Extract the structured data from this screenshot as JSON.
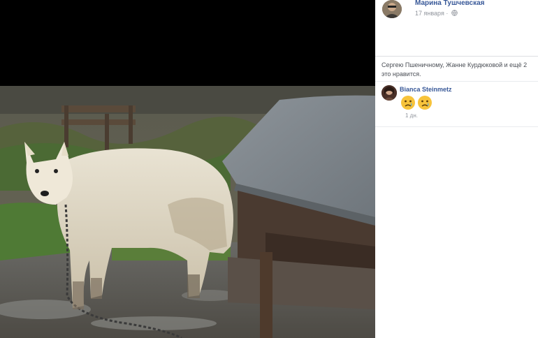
{
  "post": {
    "author": "Марина Тушчевская",
    "date": "17 января",
    "date_separator": "·",
    "privacy_icon": "globe-icon"
  },
  "reactions": {
    "likes_text": "Сергею Пшеничному, Жанне Курдюковой и ещё 2 это нравится."
  },
  "comments": [
    {
      "author": "Bianca Steinmetz",
      "content_icons": [
        "crying-face-emoji",
        "crying-face-emoji"
      ],
      "time": "1 дн."
    }
  ],
  "photo": {
    "subject_icon": "white-husky-dog-photo"
  },
  "colors": {
    "link": "#385898",
    "meta": "#90949c",
    "text": "#4b4f56",
    "viewer_bg": "#000000"
  }
}
